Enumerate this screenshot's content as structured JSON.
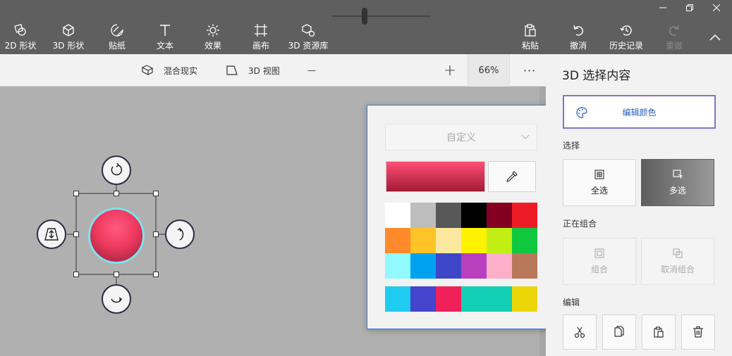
{
  "toolbar": {
    "tools": [
      {
        "label": "2D 形状",
        "icon": "2d-shapes-icon"
      },
      {
        "label": "3D 形状",
        "icon": "3d-shapes-icon"
      },
      {
        "label": "贴纸",
        "icon": "stickers-icon"
      },
      {
        "label": "文本",
        "icon": "text-icon"
      },
      {
        "label": "效果",
        "icon": "effects-icon"
      },
      {
        "label": "画布",
        "icon": "canvas-icon"
      },
      {
        "label": "3D 资源库",
        "icon": "3d-library-icon"
      }
    ],
    "paste_label": "粘贴",
    "undo_label": "撤消",
    "history_label": "历史记录",
    "redo_label": "重做"
  },
  "subbar": {
    "mixed_reality_label": "混合现实",
    "view_3d_label": "3D 视图",
    "zoom_minus": "—",
    "zoom_plus": "+",
    "zoom_level": "66%",
    "zoom_fraction": 0.33,
    "more": "···"
  },
  "picker": {
    "dropdown_value": "自定义",
    "current_color": [
      "#ff4f75",
      "#a21a36"
    ],
    "swatches": [
      "#ffffff",
      "#bdbdbd",
      "#585858",
      "#000000",
      "#840021",
      "#ed1c24",
      "#fe8a2b",
      "#fec326",
      "#fde8a0",
      "#fef200",
      "#c1ef15",
      "#10c840",
      "#90fafe",
      "#00a2ef",
      "#3e47c8",
      "#ba3fbe",
      "#fdafc9",
      "#b8785a"
    ],
    "recent": [
      "#1fccef",
      "#4444cc",
      "#f0205a",
      "#13cfb5",
      "#ecd608"
    ]
  },
  "panel": {
    "title": "3D 选择内容",
    "edit_color_label": "编辑颜色",
    "select_section": "选择",
    "select_all_label": "全选",
    "multi_select_label": "多选",
    "group_section": "正在组合",
    "group_label": "组合",
    "ungroup_label": "取消组合",
    "edit_section": "编辑"
  },
  "colors": {
    "toolbar_bg": "#5f5f5f",
    "panel_bg": "#f2f2f2",
    "canvas_bg": "#b0b0b0",
    "accent": "#3b78c9",
    "selection_ring": "#7de3ef",
    "object_color": "#f03a5f"
  }
}
